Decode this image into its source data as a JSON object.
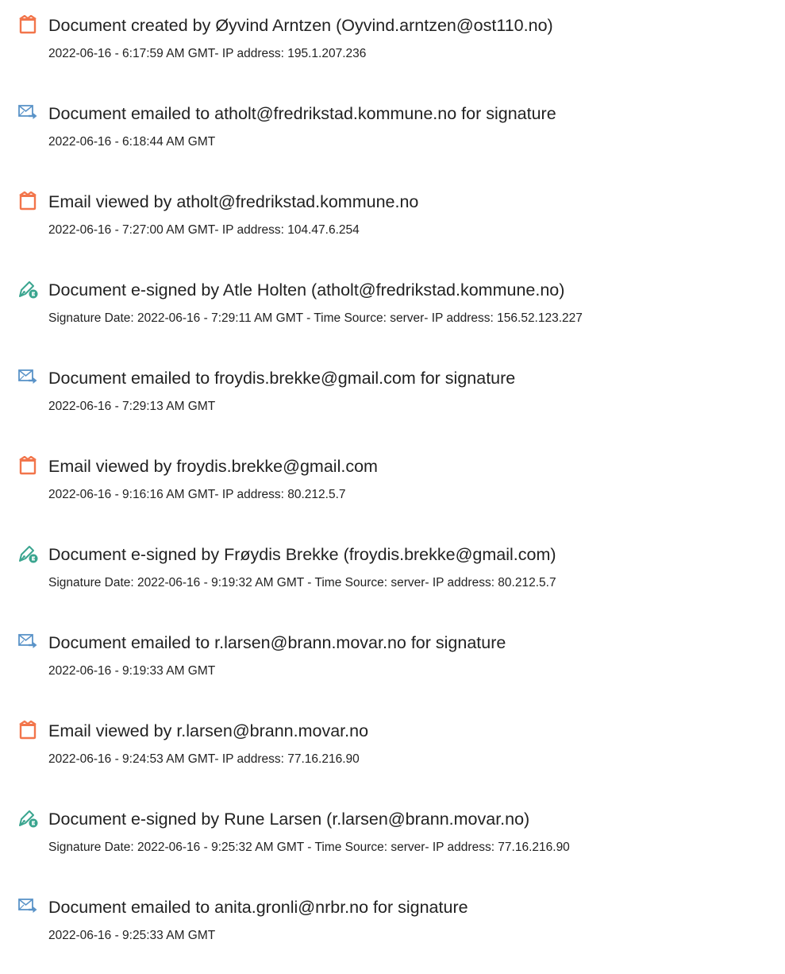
{
  "icon_colors": {
    "created": "#f2754b",
    "viewed": "#f2754b",
    "emailed": "#5a93c8",
    "esigned": "#3aa58f"
  },
  "events": [
    {
      "kind": "created",
      "icon": "document-created-icon",
      "title": "Document created by Øyvind Arntzen (Oyvind.arntzen@ost110.no)",
      "meta": "2022-06-16 - 6:17:59 AM GMT- IP address: 195.1.207.236"
    },
    {
      "kind": "emailed",
      "icon": "email-sent-icon",
      "title": "Document emailed to atholt@fredrikstad.kommune.no for signature",
      "meta": "2022-06-16 - 6:18:44 AM GMT"
    },
    {
      "kind": "viewed",
      "icon": "email-viewed-icon",
      "title": "Email viewed by atholt@fredrikstad.kommune.no",
      "meta": "2022-06-16 - 7:27:00 AM GMT- IP address: 104.47.6.254"
    },
    {
      "kind": "esigned",
      "icon": "e-signed-pen-icon",
      "title": "Document e-signed by Atle Holten (atholt@fredrikstad.kommune.no)",
      "meta": "Signature Date: 2022-06-16 - 7:29:11 AM GMT - Time Source: server- IP address: 156.52.123.227"
    },
    {
      "kind": "emailed",
      "icon": "email-sent-icon",
      "title": "Document emailed to froydis.brekke@gmail.com for signature",
      "meta": "2022-06-16 - 7:29:13 AM GMT"
    },
    {
      "kind": "viewed",
      "icon": "email-viewed-icon",
      "title": "Email viewed by froydis.brekke@gmail.com",
      "meta": "2022-06-16 - 9:16:16 AM GMT- IP address: 80.212.5.7"
    },
    {
      "kind": "esigned",
      "icon": "e-signed-pen-icon",
      "title": "Document e-signed by Frøydis Brekke (froydis.brekke@gmail.com)",
      "meta": "Signature Date: 2022-06-16 - 9:19:32 AM GMT - Time Source: server- IP address: 80.212.5.7"
    },
    {
      "kind": "emailed",
      "icon": "email-sent-icon",
      "title": "Document emailed to r.larsen@brann.movar.no for signature",
      "meta": "2022-06-16 - 9:19:33 AM GMT"
    },
    {
      "kind": "viewed",
      "icon": "email-viewed-icon",
      "title": "Email viewed by r.larsen@brann.movar.no",
      "meta": "2022-06-16 - 9:24:53 AM GMT- IP address: 77.16.216.90"
    },
    {
      "kind": "esigned",
      "icon": "e-signed-pen-icon",
      "title": "Document e-signed by Rune Larsen (r.larsen@brann.movar.no)",
      "meta": "Signature Date: 2022-06-16 - 9:25:32 AM GMT - Time Source: server- IP address: 77.16.216.90"
    },
    {
      "kind": "emailed",
      "icon": "email-sent-icon",
      "title": "Document emailed to anita.gronli@nrbr.no for signature",
      "meta": "2022-06-16 - 9:25:33 AM GMT"
    }
  ]
}
